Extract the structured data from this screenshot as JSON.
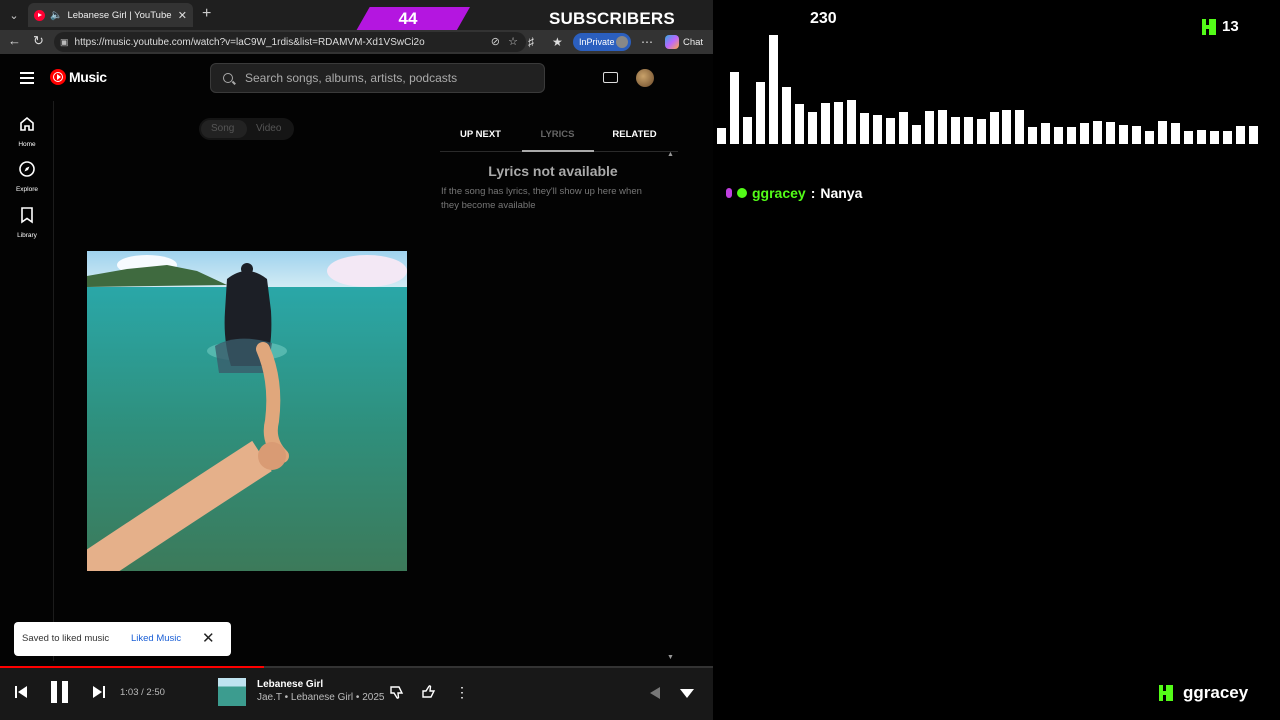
{
  "browser": {
    "tab_title": "Lebanese Girl | YouTube Music",
    "url_host": "https://music.youtube.com",
    "url_path": "/watch?v=laC9W_1rdis&list=RDAMVM-Xd1VSwCi2o",
    "inprivate_label": "InPrivate",
    "chat_label": "Chat"
  },
  "overlay": {
    "subscriber_count": "44",
    "subscribers_label": "SUBSCRIBERS",
    "visualizer_count": "230",
    "kick_viewers": "13",
    "chat_user": "ggracey",
    "chat_separator": ":",
    "chat_message": "Nanya",
    "footer_name": "ggracey",
    "visualizer_levels": [
      0.14,
      0.63,
      0.24,
      0.54,
      0.96,
      0.5,
      0.35,
      0.28,
      0.36,
      0.37,
      0.39,
      0.27,
      0.25,
      0.23,
      0.28,
      0.17,
      0.29,
      0.3,
      0.24,
      0.24,
      0.22,
      0.28,
      0.3,
      0.3,
      0.15,
      0.18,
      0.15,
      0.15,
      0.18,
      0.2,
      0.19,
      0.17,
      0.16,
      0.11,
      0.2,
      0.18,
      0.11,
      0.12,
      0.11,
      0.11,
      0.16,
      0.16
    ]
  },
  "ytm": {
    "logo_text": "Music",
    "search_placeholder": "Search songs, albums, artists, podcasts",
    "sidebar": [
      {
        "label": "Home"
      },
      {
        "label": "Explore"
      },
      {
        "label": "Library"
      }
    ],
    "toggle": {
      "song": "Song",
      "video": "Video"
    },
    "tabs": [
      "UP NEXT",
      "LYRICS",
      "RELATED"
    ],
    "lyrics_title": "Lyrics not available",
    "lyrics_sub": "If the song has lyrics, they'll show up here when they become available",
    "toast": {
      "message": "Saved to liked music",
      "link": "Liked Music"
    }
  },
  "player": {
    "time": "1:03 / 2:50",
    "progress": 0.37,
    "title": "Lebanese Girl",
    "meta": "Jae.T • Lebanese Girl • 2025"
  }
}
